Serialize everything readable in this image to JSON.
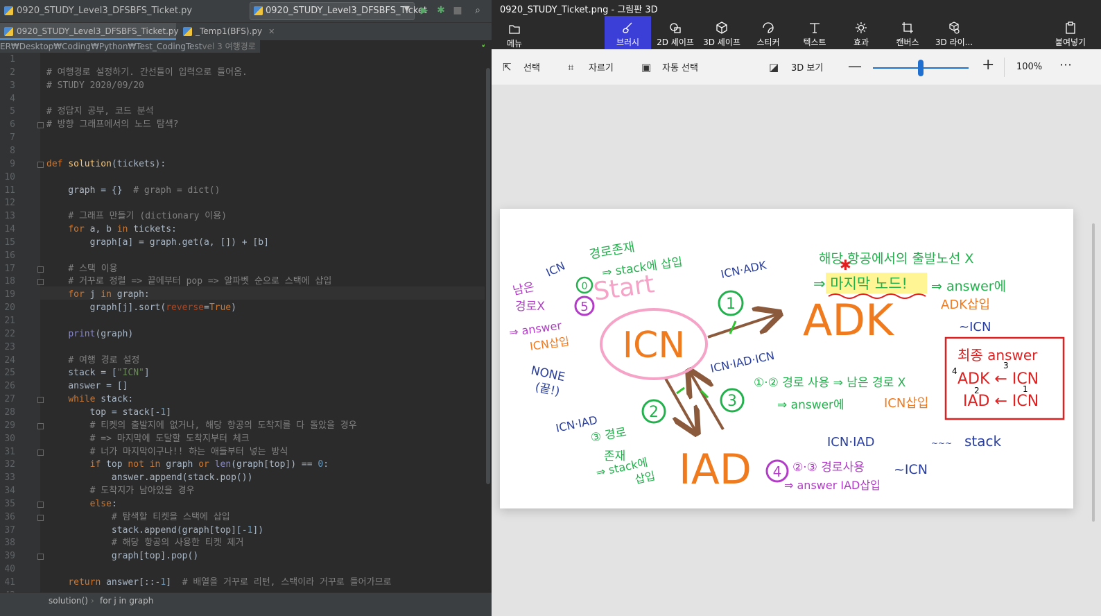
{
  "ide": {
    "title": "0920_STUDY_Level3_DFSBFS_Ticket.py",
    "run_config": "0920_STUDY_Level3_DFSBFS_Ticket",
    "tabs": [
      {
        "label": "0920_STUDY_Level3_DFSBFS_Ticket.py",
        "active": true
      },
      {
        "label": "_Temp1(BFS).py",
        "active": false
      }
    ],
    "path_overlay": "ER₩Desktop₩Coding₩Python₩Test_CodingTest",
    "line1_tail": "vel 3 여행경로",
    "breadcrumbs": [
      "solution()",
      "for j in graph"
    ]
  },
  "code_lines": [
    "",
    "# 여행경로 설정하기. 간선들이 입력으로 들어옴.",
    "# STUDY 2020/09/20",
    "",
    "# 정답지 공부, 코드 분석",
    "# 방향 그래프에서의 노드 탐색?",
    "",
    "",
    "def solution(tickets):",
    "",
    "    graph = {}  # graph = dict()",
    "",
    "    # 그래프 만들기 (dictionary 이용)",
    "    for a, b in tickets:",
    "        graph[a] = graph.get(a, []) + [b]",
    "",
    "    # 스택 이용",
    "    # 거꾸로 정렬 => 끝에부터 pop => 알파벳 순으로 스택에 삽입",
    "    for j in graph:",
    "        graph[j].sort(reverse=True)",
    "",
    "    print(graph)",
    "",
    "    # 여행 경로 설정",
    "    stack = [\"ICN\"]",
    "    answer = []",
    "    while stack:",
    "        top = stack[-1]",
    "        # 티켓의 출발지에 없거나, 해당 항공의 도착지를 다 돌았을 경우",
    "        # => 마지막에 도달할 도착지부터 체크",
    "        # 너가 마지막이구나!! 하는 애들부터 넣는 방식",
    "        if top not in graph or len(graph[top]) == 0:",
    "            answer.append(stack.pop())",
    "        # 도착지가 남아있을 경우",
    "        else:",
    "            # 탐색할 티켓을 스택에 삽입",
    "            stack.append(graph[top][-1])",
    "            # 해당 항공의 사용한 티켓 제거",
    "            graph[top].pop()",
    "",
    "    return answer[::-1]  # 배열을 거꾸로 리턴, 스택이라 거꾸로 들어가므로",
    ""
  ],
  "paint": {
    "title": "0920_STUDY_Ticket.png - 그림판 3D",
    "ribbon": [
      {
        "label": "메뉴",
        "icon": "folder-icon"
      },
      {
        "label": "브러시",
        "icon": "brush-icon",
        "active": true
      },
      {
        "label": "2D 셰이프",
        "icon": "2d-shapes-icon"
      },
      {
        "label": "3D 셰이프",
        "icon": "3d-shapes-icon"
      },
      {
        "label": "스티커",
        "icon": "sticker-icon"
      },
      {
        "label": "텍스트",
        "icon": "text-icon"
      },
      {
        "label": "효과",
        "icon": "effects-icon"
      },
      {
        "label": "캔버스",
        "icon": "canvas-icon"
      },
      {
        "label": "3D 라이...",
        "icon": "3d-library-icon"
      },
      {
        "label": "붙여넣기",
        "icon": "paste-icon"
      }
    ],
    "toolbar": {
      "select": "선택",
      "crop": "자르기",
      "magic_select": "자동 선택",
      "view3d": "3D 보기",
      "zoom": "100%",
      "zoom_level": 0.5
    },
    "drawing": {
      "start": "Start",
      "icn": "ICN",
      "adk": "ADK",
      "iad": "IAD",
      "note_top_a": "경로존재",
      "note_top_b": "⇒ stack에 삽입",
      "note_top_icn": "ICN",
      "circle0": "0",
      "remaining_a": "남은",
      "remaining_b": "경로X",
      "circle5": "5",
      "ans_a": "⇒ answer",
      "ans_b": "ICN삽입",
      "none_a": "NONE",
      "none_b": "(끝!)",
      "icn_adk": "ICN·ADK",
      "circle1": "1",
      "adk_note_top": "해당 항공에서의 출발노선 X",
      "last_node": "⇒ 마지막 노드!",
      "adk_ans_a": "⇒ answer에",
      "adk_ans_b": "ADK삽입",
      "adk_icn": "~ICN",
      "icn_iad_icn": "ICN·IAD·ICN",
      "circle3": "3",
      "route12": "①·② 경로 사용 ⇒ 남은 경로 X",
      "route12_b": "⇒ answer에",
      "route12_c": "ICN삽입",
      "circle2": "2",
      "icn_iad": "ICN·IAD",
      "route3_a": "③ 경로",
      "route3_b": "존재",
      "route3_c": "⇒ stack에",
      "route3_d": "삽입",
      "icn_iad2": "ICN·IAD",
      "stack_lbl": "stack",
      "circle4": "4",
      "route23": "②·③ 경로사용",
      "route23_b": "⇒ answer IAD삽입",
      "route23_icn": "~ICN",
      "final_title": "최종 answer",
      "final_r1": "ADK ← ICN",
      "final_r2": "IAD ← ICN",
      "n1": "1",
      "n2": "2",
      "n3": "3",
      "n4": "4"
    }
  }
}
